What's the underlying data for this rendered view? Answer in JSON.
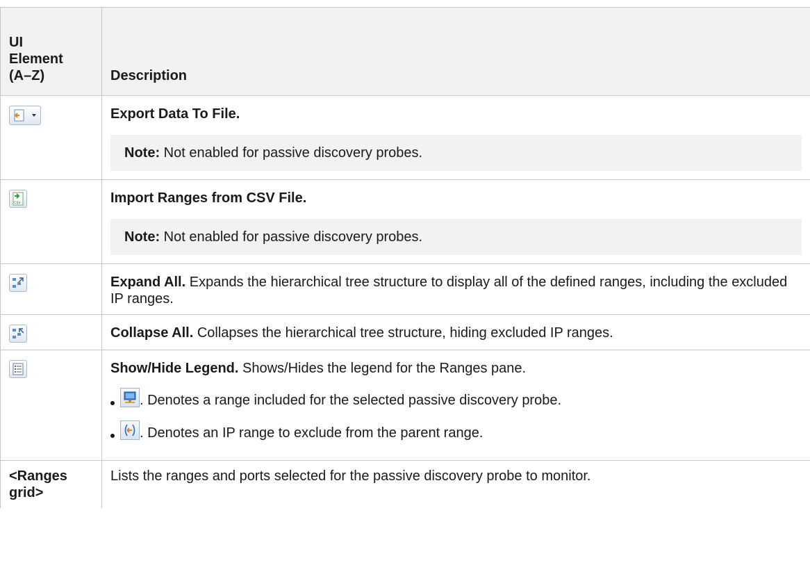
{
  "table": {
    "header": {
      "col1_line1": "UI",
      "col1_line2": "Element",
      "col1_line3": "(A–Z)",
      "col2": "Description"
    },
    "rows": [
      {
        "icon": "export-data-icon",
        "title": "Export Data To File.",
        "note_label": "Note:",
        "note_text": " Not enabled for passive discovery probes."
      },
      {
        "icon": "import-csv-icon",
        "title": "Import Ranges from CSV File.",
        "note_label": "Note:",
        "note_text": " Not enabled for passive discovery probes."
      },
      {
        "icon": "expand-all-icon",
        "title": "Expand All.",
        "text": " Expands the hierarchical tree structure to display all of the defined ranges, including the excluded IP ranges."
      },
      {
        "icon": "collapse-all-icon",
        "title": "Collapse All.",
        "text": " Collapses the hierarchical tree structure, hiding excluded IP ranges."
      },
      {
        "icon": "legend-icon",
        "title": "Show/Hide Legend.",
        "text": " Shows/Hides the legend for the Ranges pane.",
        "bullets": [
          {
            "icon": "included-range-icon",
            "text": ". Denotes a range included for the selected passive discovery probe."
          },
          {
            "icon": "excluded-range-icon",
            "text": ". Denotes an IP range to exclude from the parent range."
          }
        ]
      },
      {
        "element_line1": "<Ranges",
        "element_line2": "grid>",
        "text": "Lists the ranges and ports selected for the passive discovery probe to monitor."
      }
    ]
  }
}
